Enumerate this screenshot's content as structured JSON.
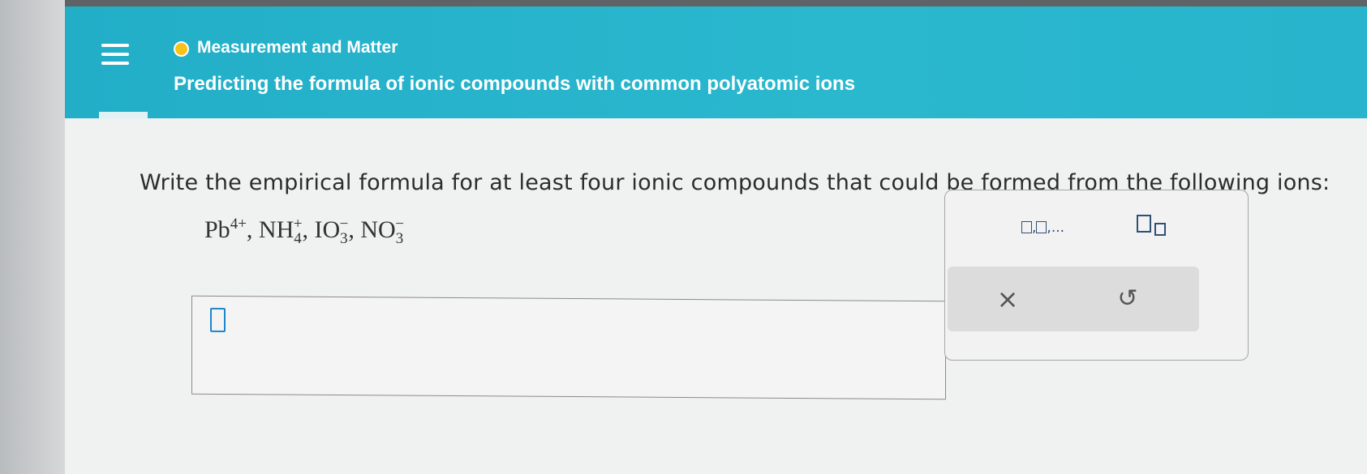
{
  "header": {
    "topic": "Measurement and Matter",
    "title": "Predicting the formula of ionic compounds with common polyatomic ions",
    "status_color": "#f6c21a",
    "accent_color": "#27b4cc"
  },
  "icons": {
    "menu": "hamburger-menu-icon",
    "collapse": "chevron-down-icon",
    "clear": "x-icon",
    "undo": "undo-icon"
  },
  "question": {
    "prompt": "Write the empirical formula for at least four ionic compounds that could be formed from the following ions:",
    "ions": [
      {
        "base": "Pb",
        "sub": "",
        "sup": "4+"
      },
      {
        "base": "NH",
        "sub": "4",
        "sup": "+"
      },
      {
        "base": "IO",
        "sub": "3",
        "sup": "−"
      },
      {
        "base": "NO",
        "sub": "3",
        "sup": "−"
      }
    ]
  },
  "answer": {
    "value": ""
  },
  "toolbar": {
    "list_label": ",",
    "list_ellipsis": "...",
    "clear_symbol": "×",
    "undo_symbol": "↺"
  }
}
